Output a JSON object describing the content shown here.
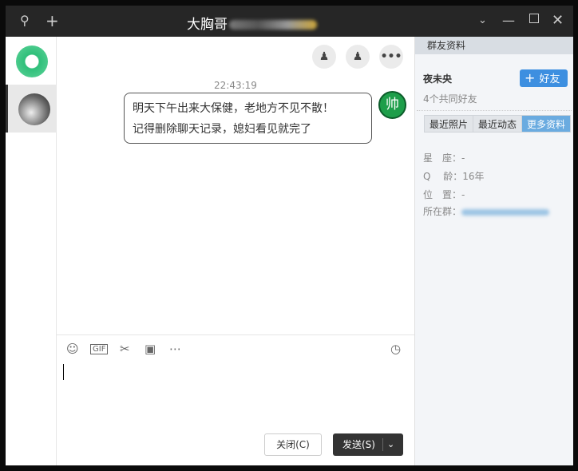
{
  "titlebar": {
    "title": "大胸哥"
  },
  "chat": {
    "time": "22:43:19",
    "message": {
      "line1": "明天下午出来大保健，老地方不见不散！",
      "line2": "记得删除聊天记录，媳妇看见就完了"
    },
    "my_avatar": "帅"
  },
  "editor": {
    "gif": "GIF",
    "close_label": "关闭(C)",
    "send_label": "发送(S)"
  },
  "profile": {
    "header": "群友资料",
    "name": "夜未央",
    "add_friend": "好友",
    "mutual": "4个共同好友",
    "tabs": [
      "最近照片",
      "最近动态",
      "更多资料"
    ],
    "fields": [
      {
        "k": "星　座：",
        "v": "-"
      },
      {
        "k": "Q　 龄：",
        "v": "16年"
      },
      {
        "k": "位　置：",
        "v": "-"
      },
      {
        "k": "所在群：",
        "v": ""
      }
    ]
  },
  "colors": {
    "accent": "#3d8fe0",
    "titlebar": "#262626"
  }
}
